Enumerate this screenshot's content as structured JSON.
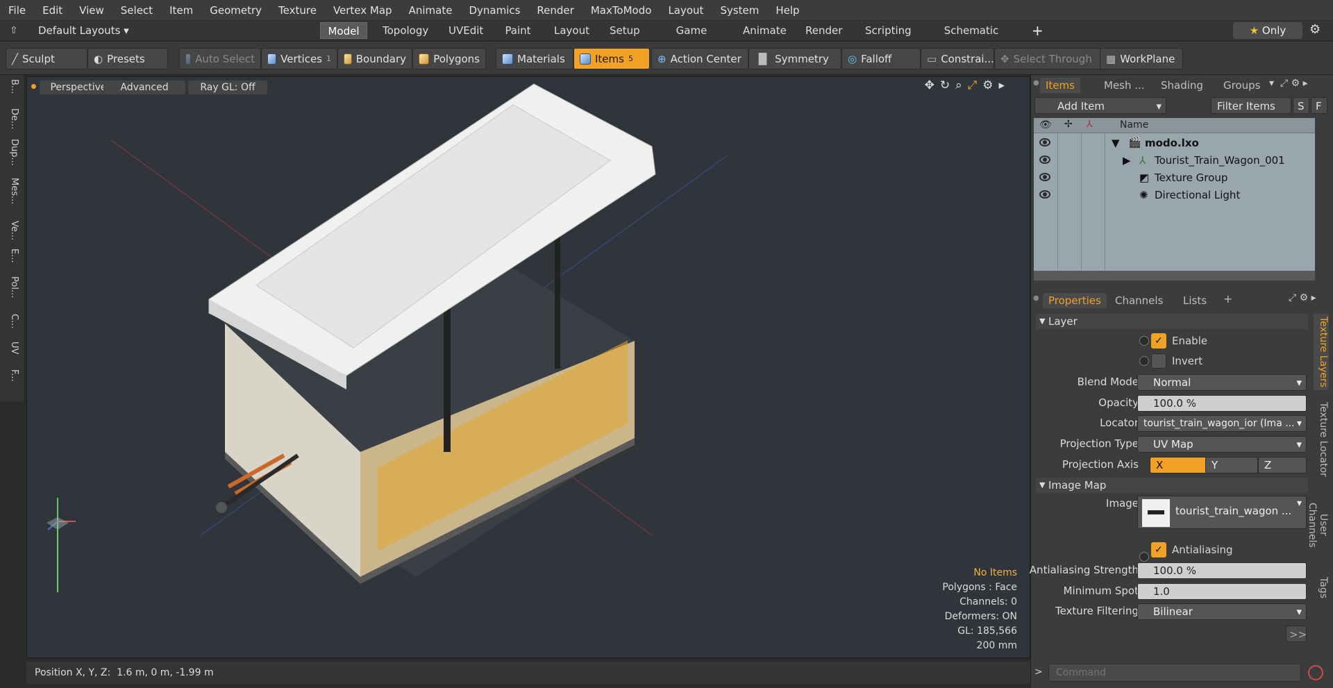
{
  "menu": [
    "File",
    "Edit",
    "View",
    "Select",
    "Item",
    "Geometry",
    "Texture",
    "Vertex Map",
    "Animate",
    "Dynamics",
    "Render",
    "MaxToModo",
    "Layout",
    "System",
    "Help"
  ],
  "layout_selector": "Default Layouts ▾",
  "tabs": [
    "Model",
    "Topology",
    "UVEdit",
    "Paint",
    "Layout",
    "Setup",
    "Game Tools",
    "Animate",
    "Render",
    "Scripting",
    "Schematic Fusion"
  ],
  "tabs_active": "Model",
  "only_label": "Only",
  "toolbar": {
    "sculpt": "Sculpt",
    "presets": "Presets",
    "auto_select": "Auto Select",
    "vertices": "Vertices",
    "vertices_count": "1",
    "boundary": "Boundary",
    "polygons": "Polygons",
    "materials": "Materials",
    "items": "Items",
    "items_count": "5",
    "action_center": "Action Center",
    "symmetry": "Symmetry",
    "falloff": "Falloff",
    "constraints": "Constrai...",
    "select_through": "Select Through",
    "workplane": "WorkPlane"
  },
  "left_tools": [
    "B...",
    "De...",
    "Dup...",
    "Mes...",
    "Ve...",
    "E...",
    "Pol...",
    "C...",
    "UV",
    "F..."
  ],
  "viewport": {
    "perspective": "Perspective",
    "advanced": "Advanced",
    "raygl": "Ray GL: Off",
    "info": {
      "items": "No Items",
      "polygons": "Polygons : Face",
      "channels": "Channels: 0",
      "deformers": "Deformers: ON",
      "gl": "GL: 185,566",
      "size": "200 mm"
    }
  },
  "status": {
    "label": "Position X, Y, Z:",
    "value": "1.6 m, 0 m, -1.99 m"
  },
  "items_panel": {
    "tabs": [
      "Items",
      "Mesh ...",
      "Shading",
      "Groups"
    ],
    "add_item": "Add Item",
    "filter": "Filter Items",
    "s": "S",
    "f": "F",
    "col_name": "Name",
    "rows": [
      {
        "name": "modo.lxo"
      },
      {
        "name": "Tourist_Train_Wagon_001"
      },
      {
        "name": "Texture Group"
      },
      {
        "name": "Directional Light"
      }
    ]
  },
  "props_panel": {
    "tabs": [
      "Properties",
      "Channels",
      "Lists"
    ],
    "layer_section": "Layer",
    "enable": "Enable",
    "invert": "Invert",
    "blend_mode_label": "Blend Mode",
    "blend_mode": "Normal",
    "opacity_label": "Opacity",
    "opacity": "100.0 %",
    "locator_label": "Locator",
    "locator": "tourist_train_wagon_ior (Ima ...",
    "proj_type_label": "Projection Type",
    "proj_type": "UV Map",
    "proj_axis_label": "Projection Axis",
    "axis_x": "X",
    "axis_y": "Y",
    "axis_z": "Z",
    "image_section": "Image Map",
    "image_label": "Image",
    "image": "tourist_train_wagon ...",
    "antialiasing": "Antialiasing",
    "aa_strength_label": "Antialiasing Strength",
    "aa_strength": "100.0 %",
    "min_spot_label": "Minimum Spot",
    "min_spot": "1.0",
    "tex_filter_label": "Texture Filtering",
    "tex_filter": "Bilinear",
    "more": ">>"
  },
  "side_tabs": [
    "Texture Layers",
    "Texture Locator",
    "User Channels",
    "Tags"
  ],
  "command_placeholder": "Command",
  "colors": {
    "accent": "#f1a126",
    "viewport_bg": "#2f353b",
    "panel_bg": "#3c3c3c"
  }
}
